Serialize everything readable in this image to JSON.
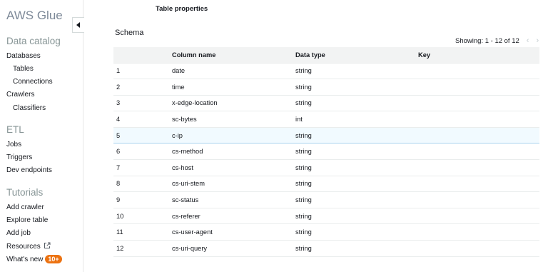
{
  "sidebar": {
    "brand": "AWS Glue",
    "data_catalog": {
      "title": "Data catalog",
      "items": [
        "Databases",
        "Tables",
        "Connections",
        "Crawlers",
        "Classifiers"
      ]
    },
    "etl": {
      "title": "ETL",
      "items": [
        "Jobs",
        "Triggers",
        "Dev endpoints"
      ]
    },
    "tutorials": {
      "title": "Tutorials",
      "items": [
        "Add crawler",
        "Explore table",
        "Add job",
        "Resources",
        "What's new"
      ],
      "whats_new_badge": "10+"
    }
  },
  "main": {
    "section_label": "Table properties",
    "schema_title": "Schema",
    "pagination": {
      "text": "Showing: 1 - 12 of 12",
      "prev_icon": "chevron-left-icon",
      "next_icon": "chevron-right-icon"
    },
    "table": {
      "headers": [
        "",
        "Column name",
        "Data type",
        "Key"
      ],
      "rows": [
        {
          "n": "1",
          "name": "date",
          "type": "string",
          "key": ""
        },
        {
          "n": "2",
          "name": "time",
          "type": "string",
          "key": ""
        },
        {
          "n": "3",
          "name": "x-edge-location",
          "type": "string",
          "key": ""
        },
        {
          "n": "4",
          "name": "sc-bytes",
          "type": "int",
          "key": ""
        },
        {
          "n": "5",
          "name": "c-ip",
          "type": "string",
          "key": ""
        },
        {
          "n": "6",
          "name": "cs-method",
          "type": "string",
          "key": ""
        },
        {
          "n": "7",
          "name": "cs-host",
          "type": "string",
          "key": ""
        },
        {
          "n": "8",
          "name": "cs-uri-stem",
          "type": "string",
          "key": ""
        },
        {
          "n": "9",
          "name": "sc-status",
          "type": "string",
          "key": ""
        },
        {
          "n": "10",
          "name": "cs-referer",
          "type": "string",
          "key": ""
        },
        {
          "n": "11",
          "name": "cs-user-agent",
          "type": "string",
          "key": ""
        },
        {
          "n": "12",
          "name": "cs-uri-query",
          "type": "string",
          "key": ""
        }
      ]
    }
  },
  "colors": {
    "brand_text": "#7d8998",
    "badge": "#ec7211",
    "row_highlight": "#f1faff",
    "header_bg": "#f2f3f3"
  }
}
